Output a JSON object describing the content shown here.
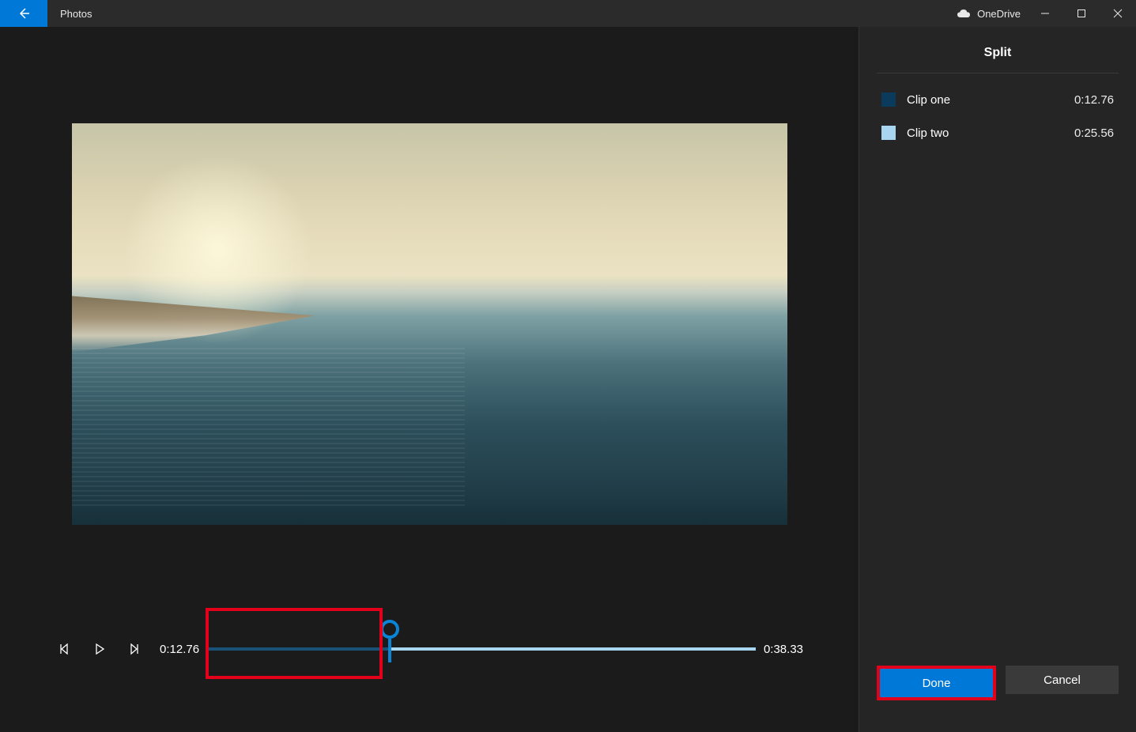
{
  "titlebar": {
    "app_name": "Photos",
    "storage_label": "OneDrive"
  },
  "playback": {
    "current_time": "0:12.76",
    "total_time": "0:38.33",
    "split_position_pct": 33.3
  },
  "panel": {
    "title": "Split",
    "clips": [
      {
        "name": "Clip one",
        "duration": "0:12.76",
        "swatch": "#0a3a5c"
      },
      {
        "name": "Clip two",
        "duration": "0:25.56",
        "swatch": "#a8d5ef"
      }
    ],
    "done_label": "Done",
    "cancel_label": "Cancel"
  }
}
